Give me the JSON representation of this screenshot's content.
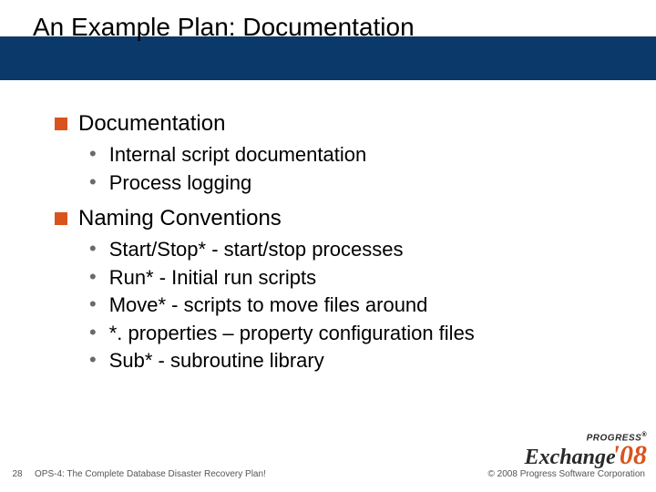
{
  "title": "An Example Plan: Documentation",
  "sections": [
    {
      "heading": "Documentation",
      "bullets": [
        "Internal script documentation",
        "Process logging"
      ]
    },
    {
      "heading": "Naming Conventions",
      "bullets": [
        "Start/Stop* - start/stop processes",
        "Run* - Initial run scripts",
        "Move* - scripts to move files around",
        "*. properties – property configuration files",
        "Sub* - subroutine library"
      ]
    }
  ],
  "footer": {
    "page_number": "28",
    "deck_title": "OPS-4: The Complete Database Disaster Recovery Plan!",
    "copyright": "© 2008 Progress Software Corporation"
  },
  "logo": {
    "top_brand": "PROGRESS",
    "reg_mark": "®",
    "word": "Exchange",
    "year_prefix": "'",
    "year": "08"
  }
}
